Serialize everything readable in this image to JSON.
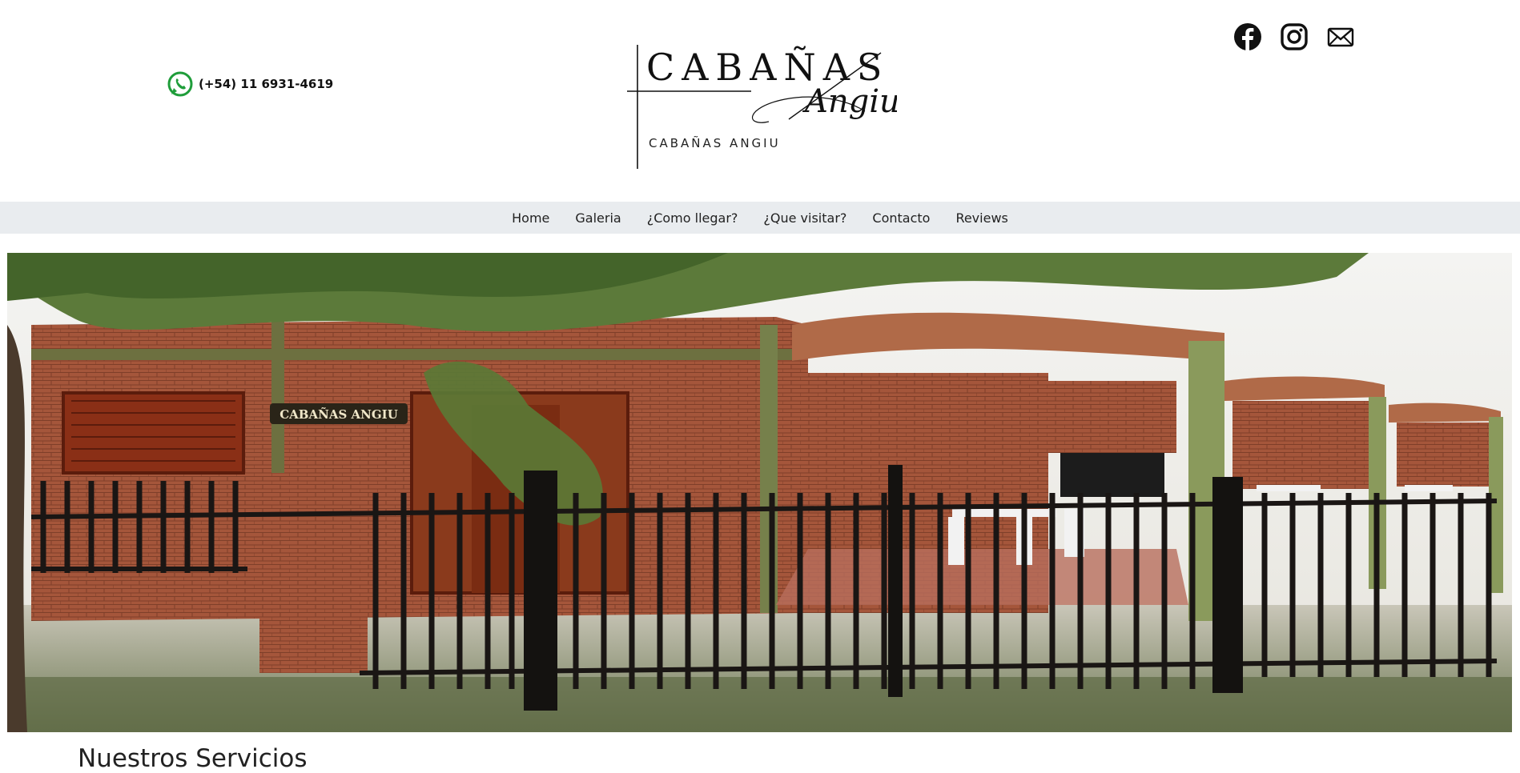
{
  "header": {
    "phone": "(+54) 11 6931-4619",
    "phone_icon": "whatsapp-icon",
    "logo": {
      "title": "CABAÑAS",
      "script": "Angiu",
      "subtitle": "CABAÑAS ANGIU"
    },
    "social_icons": [
      "facebook-icon",
      "instagram-icon",
      "mail-icon"
    ]
  },
  "nav": {
    "items": [
      {
        "label": "Home"
      },
      {
        "label": "Galeria"
      },
      {
        "label": "¿Como llegar?"
      },
      {
        "label": "¿Que visitar?"
      },
      {
        "label": "Contacto"
      },
      {
        "label": "Reviews"
      }
    ]
  },
  "hero": {
    "sign_text": "CABAÑAS ANGIU"
  },
  "main": {
    "section_title": "Nuestros Servicios"
  },
  "colors": {
    "nav_bg": "#e9ecef",
    "whatsapp_green": "#1f9d3a",
    "text": "#222222"
  }
}
